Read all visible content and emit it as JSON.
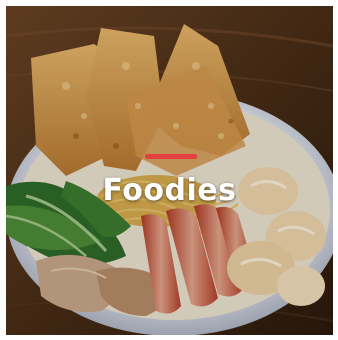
{
  "card": {
    "title": "Foodies",
    "accent_color": "#e2413f",
    "title_color": "#ffffff"
  },
  "photo": {
    "subject": "wonton-noodle-bowl"
  }
}
